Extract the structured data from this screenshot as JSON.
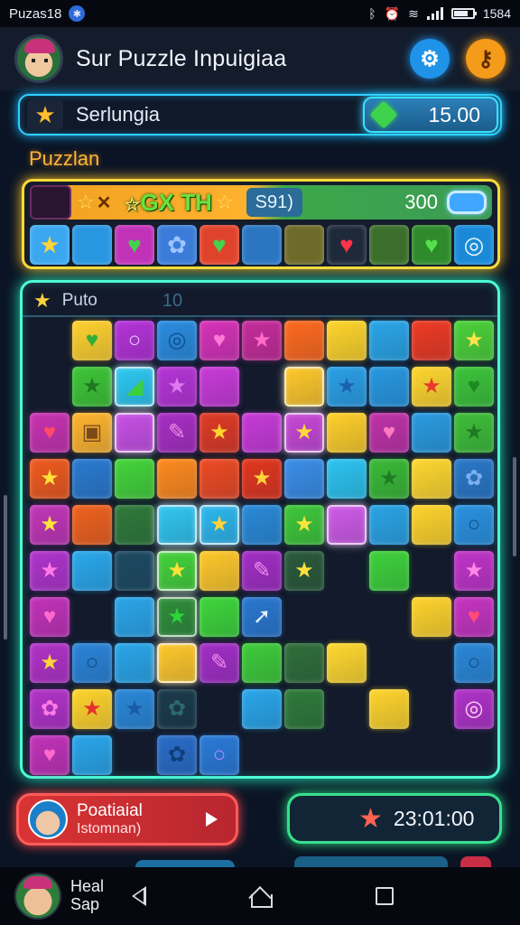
{
  "status_bar": {
    "app_name": "Puzas18",
    "time": "1584"
  },
  "header": {
    "title": "Sur Puzzle Inpuigiaa",
    "icons": [
      "avatar",
      "gear-icon",
      "key-icon"
    ]
  },
  "level_bar": {
    "label": "Serlungia",
    "score": "15.00",
    "icon": "lightning-star-icon"
  },
  "section_title": "Puzzlan",
  "combo": {
    "banner_text": "GX TH",
    "count": "S91)",
    "score": "300",
    "queue": [
      {
        "color": "#3aa7f0",
        "symbol": "★",
        "symbol_color": "#ffd43a"
      },
      {
        "color": "#2896e0",
        "symbol": "",
        "symbol_color": "#ffffff"
      },
      {
        "color": "#c132b8",
        "symbol": "♥",
        "symbol_color": "#42d44a"
      },
      {
        "color": "#3a7cd8",
        "symbol": "✿",
        "symbol_color": "#9fc3ff"
      },
      {
        "color": "#e0432c",
        "symbol": "♥",
        "symbol_color": "#42d44a"
      },
      {
        "color": "#2a76c0",
        "symbol": "",
        "symbol_color": "#ffffff"
      },
      {
        "color": "#6d6a2a",
        "symbol": "",
        "symbol_color": "#ffffff"
      },
      {
        "color": "#1e2a3a",
        "symbol": "♥",
        "symbol_color": "#ff3448"
      },
      {
        "color": "#3a6e2a",
        "symbol": "",
        "symbol_color": "#ffffff"
      },
      {
        "color": "#2f8a2c",
        "symbol": "♥",
        "symbol_color": "#54e04a"
      },
      {
        "color": "#1a8ad8",
        "symbol": "◎",
        "symbol_color": "#e8f6ff"
      }
    ]
  },
  "board": {
    "name": "Puto",
    "moves": "10",
    "cells": [
      {
        "r": 0,
        "c": 1,
        "color": "#ffd12e",
        "sym": "♥",
        "sc": "#2fae3a"
      },
      {
        "r": 0,
        "c": 2,
        "color": "#b532d8",
        "sym": "○",
        "sc": "#e8c8ff"
      },
      {
        "r": 0,
        "c": 3,
        "color": "#2a8de0",
        "sym": "◎",
        "sc": "#0f4f8e"
      },
      {
        "r": 0,
        "c": 4,
        "color": "#d632b8",
        "sym": "♥",
        "sc": "#ff7ad6"
      },
      {
        "r": 0,
        "c": 5,
        "color": "#c62c9a",
        "sym": "★",
        "sc": "#ff6cc8"
      },
      {
        "r": 0,
        "c": 6,
        "color": "#ff6a1e",
        "sym": "",
        "sc": "#fff"
      },
      {
        "r": 0,
        "c": 7,
        "color": "#ffd52a",
        "sym": "",
        "sc": "#fff"
      },
      {
        "r": 0,
        "c": 8,
        "color": "#2aa6e8",
        "sym": "",
        "sc": "#fff"
      },
      {
        "r": 0,
        "c": 9,
        "color": "#ee3a24",
        "sym": "",
        "sc": "#fff"
      },
      {
        "r": 0,
        "c": 10,
        "color": "#4cd23a",
        "sym": "★",
        "sc": "#ffe34a"
      },
      {
        "r": 1,
        "c": 1,
        "color": "#3ec636",
        "sym": "★",
        "sc": "#1d7a22"
      },
      {
        "r": 1,
        "c": 2,
        "color": "#2ec8f0",
        "sym": "◢",
        "sc": "#3bd03a",
        "glow": true
      },
      {
        "r": 1,
        "c": 3,
        "color": "#b634d6",
        "sym": "★",
        "sc": "#e07af0"
      },
      {
        "r": 1,
        "c": 4,
        "color": "#c83ad8",
        "sym": "",
        "sc": "#fff"
      },
      {
        "r": 1,
        "c": 6,
        "color": "#ffc82a",
        "sym": "",
        "sc": "#fff",
        "glow": true
      },
      {
        "r": 1,
        "c": 7,
        "color": "#2aa0e6",
        "sym": "★",
        "sc": "#1a62b0"
      },
      {
        "r": 1,
        "c": 8,
        "color": "#2898e2",
        "sym": "",
        "sc": "#fff"
      },
      {
        "r": 1,
        "c": 9,
        "color": "#ffd62e",
        "sym": "★",
        "sc": "#e83a2a"
      },
      {
        "r": 1,
        "c": 10,
        "color": "#3cc43a",
        "sym": "♥",
        "sc": "#1e8a22"
      },
      {
        "r": 2,
        "c": 0,
        "color": "#c832b0",
        "sym": "♥",
        "sc": "#ff4a6a"
      },
      {
        "r": 2,
        "c": 1,
        "color": "#ffb52e",
        "sym": "▣",
        "sc": "#7a4a1a"
      },
      {
        "r": 2,
        "c": 2,
        "color": "#c850e6",
        "sym": "",
        "sc": "#fff",
        "glow": true
      },
      {
        "r": 2,
        "c": 3,
        "color": "#a82ec4",
        "sym": "✎",
        "sc": "#f08ae8"
      },
      {
        "r": 2,
        "c": 4,
        "color": "#e03a26",
        "sym": "★",
        "sc": "#ffd22e"
      },
      {
        "r": 2,
        "c": 5,
        "color": "#c83ad8",
        "sym": "",
        "sc": "#fff"
      },
      {
        "r": 2,
        "c": 6,
        "color": "#c848d8",
        "sym": "★",
        "sc": "#ffd83a",
        "glow": true
      },
      {
        "r": 2,
        "c": 7,
        "color": "#ffcf2a",
        "sym": "",
        "sc": "#fff"
      },
      {
        "r": 2,
        "c": 8,
        "color": "#c032a8",
        "sym": "♥",
        "sc": "#ff7ac0"
      },
      {
        "r": 2,
        "c": 9,
        "color": "#2a9be0",
        "sym": "",
        "sc": "#fff"
      },
      {
        "r": 2,
        "c": 10,
        "color": "#3ebe38",
        "sym": "★",
        "sc": "#1e7a22"
      },
      {
        "r": 3,
        "c": 0,
        "color": "#f05a1e",
        "sym": "★",
        "sc": "#ffe13a"
      },
      {
        "r": 3,
        "c": 1,
        "color": "#2a7ad0",
        "sym": "",
        "sc": "#fff"
      },
      {
        "r": 3,
        "c": 2,
        "color": "#44d43a",
        "sym": "",
        "sc": "#fff"
      },
      {
        "r": 3,
        "c": 3,
        "color": "#ff8a1e",
        "sym": "",
        "sc": "#fff"
      },
      {
        "r": 3,
        "c": 4,
        "color": "#ee4a24",
        "sym": "",
        "sc": "#fff"
      },
      {
        "r": 3,
        "c": 5,
        "color": "#e2361e",
        "sym": "★",
        "sc": "#ffd23a"
      },
      {
        "r": 3,
        "c": 6,
        "color": "#3a8ee8",
        "sym": "",
        "sc": "#fff"
      },
      {
        "r": 3,
        "c": 7,
        "color": "#2cc4f0",
        "sym": "",
        "sc": "#fff"
      },
      {
        "r": 3,
        "c": 8,
        "color": "#3aba36",
        "sym": "★",
        "sc": "#1e7c22"
      },
      {
        "r": 3,
        "c": 9,
        "color": "#ffd82e",
        "sym": "",
        "sc": "#fff"
      },
      {
        "r": 3,
        "c": 10,
        "color": "#2a78c8",
        "sym": "✿",
        "sc": "#7aaef0"
      },
      {
        "r": 4,
        "c": 0,
        "color": "#c236b8",
        "sym": "★",
        "sc": "#ffe23a"
      },
      {
        "r": 4,
        "c": 1,
        "color": "#f0621e",
        "sym": "",
        "sc": "#fff"
      },
      {
        "r": 4,
        "c": 2,
        "color": "#2f7a3a",
        "sym": "",
        "sc": "#fff"
      },
      {
        "r": 4,
        "c": 3,
        "color": "#30c6f0",
        "sym": "",
        "sc": "#fff",
        "glow": true
      },
      {
        "r": 4,
        "c": 4,
        "color": "#2eb8ee",
        "sym": "★",
        "sc": "#ffd43a",
        "glow": true
      },
      {
        "r": 4,
        "c": 5,
        "color": "#2a8ad8",
        "sym": "",
        "sc": "#fff"
      },
      {
        "r": 4,
        "c": 6,
        "color": "#3ec83a",
        "sym": "★",
        "sc": "#ffe43a"
      },
      {
        "r": 4,
        "c": 7,
        "color": "#d05ae8",
        "sym": "",
        "sc": "#fff",
        "glow": true
      },
      {
        "r": 4,
        "c": 8,
        "color": "#2aa4e6",
        "sym": "",
        "sc": "#fff"
      },
      {
        "r": 4,
        "c": 9,
        "color": "#ffd42c",
        "sym": "",
        "sc": "#fff"
      },
      {
        "r": 4,
        "c": 10,
        "color": "#2a92e0",
        "sym": "○",
        "sc": "#0f4e8c"
      },
      {
        "r": 5,
        "c": 0,
        "color": "#b034cc",
        "sym": "★",
        "sc": "#ff7ae6"
      },
      {
        "r": 5,
        "c": 1,
        "color": "#2aa8ec",
        "sym": "",
        "sc": "#fff"
      },
      {
        "r": 5,
        "c": 2,
        "color": "#1d4a62",
        "sym": "",
        "sc": "#fff"
      },
      {
        "r": 5,
        "c": 3,
        "color": "#44d23a",
        "sym": "★",
        "sc": "#ffe13a",
        "glow": true
      },
      {
        "r": 5,
        "c": 4,
        "color": "#ffc82a",
        "sym": "",
        "sc": "#fff"
      },
      {
        "r": 5,
        "c": 5,
        "color": "#a22ec4",
        "sym": "✎",
        "sc": "#f090f0"
      },
      {
        "r": 5,
        "c": 6,
        "color": "#2a5a3a",
        "sym": "★",
        "sc": "#ffe13a"
      },
      {
        "r": 5,
        "c": 8,
        "color": "#3ed23a",
        "sym": "",
        "sc": "#fff"
      },
      {
        "r": 5,
        "c": 10,
        "color": "#c034c8",
        "sym": "★",
        "sc": "#ff86e6"
      },
      {
        "r": 6,
        "c": 0,
        "color": "#c232b8",
        "sym": "♥",
        "sc": "#ff6ad0"
      },
      {
        "r": 6,
        "c": 2,
        "color": "#2aa6ea",
        "sym": "",
        "sc": "#fff"
      },
      {
        "r": 6,
        "c": 3,
        "color": "#2f8e3a",
        "sym": "★",
        "sc": "#2bd43a",
        "glow": true
      },
      {
        "r": 6,
        "c": 4,
        "color": "#3ed63a",
        "sym": "",
        "sc": "#fff"
      },
      {
        "r": 6,
        "c": 5,
        "color": "#2a78d0",
        "sym": "➚",
        "sc": "#e0f0ff"
      },
      {
        "r": 6,
        "c": 9,
        "color": "#ffd42c",
        "sym": "",
        "sc": "#fff"
      },
      {
        "r": 6,
        "c": 10,
        "color": "#c634c0",
        "sym": "♥",
        "sc": "#ff4a78"
      },
      {
        "r": 7,
        "c": 0,
        "color": "#b232c8",
        "sym": "★",
        "sc": "#ffd23a"
      },
      {
        "r": 7,
        "c": 1,
        "color": "#2a84d8",
        "sym": "○",
        "sc": "#0f4a88"
      },
      {
        "r": 7,
        "c": 2,
        "color": "#2aa6ea",
        "sym": "",
        "sc": "#fff"
      },
      {
        "r": 7,
        "c": 3,
        "color": "#ffc82a",
        "sym": "",
        "sc": "#fff",
        "glow": true
      },
      {
        "r": 7,
        "c": 4,
        "color": "#a22ec6",
        "sym": "✎",
        "sc": "#f28aee"
      },
      {
        "r": 7,
        "c": 5,
        "color": "#3ecc3a",
        "sym": "",
        "sc": "#fff"
      },
      {
        "r": 7,
        "c": 6,
        "color": "#2f6e3a",
        "sym": "",
        "sc": "#fff"
      },
      {
        "r": 7,
        "c": 7,
        "color": "#ffd82e",
        "sym": "",
        "sc": "#fff"
      },
      {
        "r": 7,
        "c": 10,
        "color": "#2a88d8",
        "sym": "○",
        "sc": "#0f4a88"
      },
      {
        "r": 8,
        "c": 0,
        "color": "#b232c8",
        "sym": "✿",
        "sc": "#ff7ae6"
      },
      {
        "r": 8,
        "c": 1,
        "color": "#ffd42c",
        "sym": "★",
        "sc": "#e8302a"
      },
      {
        "r": 8,
        "c": 2,
        "color": "#2a88d8",
        "sym": "★",
        "sc": "#1a5aaa"
      },
      {
        "r": 8,
        "c": 3,
        "color": "#1a3a4a",
        "sym": "✿",
        "sc": "#2b6a6a"
      },
      {
        "r": 8,
        "c": 5,
        "color": "#2aa6ea",
        "sym": "",
        "sc": "#fff"
      },
      {
        "r": 8,
        "c": 6,
        "color": "#2f7a3a",
        "sym": "",
        "sc": "#fff"
      },
      {
        "r": 8,
        "c": 8,
        "color": "#ffd42c",
        "sym": "",
        "sc": "#fff"
      },
      {
        "r": 8,
        "c": 10,
        "color": "#b032c8",
        "sym": "◎",
        "sc": "#ffd0f6"
      },
      {
        "r": 9,
        "c": 0,
        "color": "#c232b8",
        "sym": "♥",
        "sc": "#ff6ad0"
      },
      {
        "r": 9,
        "c": 1,
        "color": "#2aa6ea",
        "sym": "",
        "sc": "#fff"
      },
      {
        "r": 9,
        "c": 3,
        "color": "#2a6cc8",
        "sym": "✿",
        "sc": "#0f3e7a"
      },
      {
        "r": 9,
        "c": 4,
        "color": "#2a7ad8",
        "sym": "○",
        "sc": "#b88aff"
      }
    ]
  },
  "player": {
    "name": "Poatiaial",
    "subtitle": "Istomnan)"
  },
  "score_card": {
    "time": "23:01:00"
  },
  "nav": {
    "line1": "Heal",
    "line2": "Sap"
  }
}
